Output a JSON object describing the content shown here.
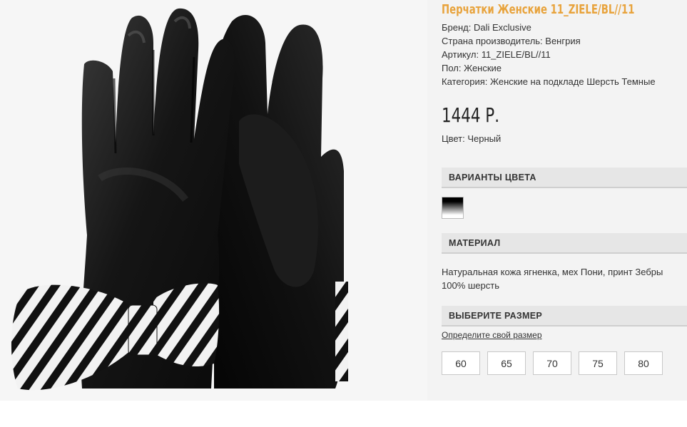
{
  "product": {
    "title": "Перчатки Женские 11_ZIELE/BL//11",
    "attributes": [
      "Бренд: Dali Exclusive",
      "Страна производитель: Венгрия",
      "Артикул: 11_ZIELE/BL//11",
      "Пол: Женские",
      "Категория: Женские на подкладе Шерсть Темные"
    ],
    "price": "1444 Р.",
    "color_line": "Цвет: Черный"
  },
  "sections": {
    "variants_title": "ВАРИАНТЫ ЦВЕТА",
    "material_title": "МАТЕРИАЛ",
    "size_title": "ВЫБЕРИТЕ РАЗМЕР"
  },
  "material": {
    "line1": "Натуральная кожа ягненка, мех Пони, принт Зебры",
    "line2": "100% шерсть"
  },
  "size_link": "Определите свой размер",
  "sizes": [
    "60",
    "65",
    "70",
    "75",
    "80"
  ],
  "colors": {
    "title_accent": "#e8a33c",
    "section_bg": "#e6e6e6",
    "info_bg": "#f3f3f3"
  }
}
